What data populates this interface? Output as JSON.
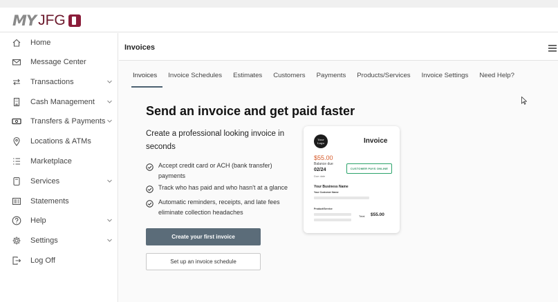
{
  "app": {
    "logo_my": "MY",
    "logo_name": "JFG"
  },
  "sidebar": {
    "items": [
      {
        "label": "Home",
        "icon": "home-icon",
        "expandable": false
      },
      {
        "label": "Message Center",
        "icon": "envelope-icon",
        "expandable": false
      },
      {
        "label": "Transactions",
        "icon": "transfer-arrows-icon",
        "expandable": true
      },
      {
        "label": "Cash Management",
        "icon": "building-icon",
        "expandable": true
      },
      {
        "label": "Transfers & Payments",
        "icon": "cash-icon",
        "expandable": true
      },
      {
        "label": "Locations & ATMs",
        "icon": "location-pin-icon",
        "expandable": false
      },
      {
        "label": "Marketplace",
        "icon": "list-icon",
        "expandable": false
      },
      {
        "label": "Services",
        "icon": "device-icon",
        "expandable": true
      },
      {
        "label": "Statements",
        "icon": "statement-icon",
        "expandable": false
      },
      {
        "label": "Help",
        "icon": "question-icon",
        "expandable": true
      },
      {
        "label": "Settings",
        "icon": "gear-icon",
        "expandable": true
      },
      {
        "label": "Log Off",
        "icon": "logout-icon",
        "expandable": false
      }
    ]
  },
  "main": {
    "page_title": "Invoices",
    "tabs": [
      {
        "label": "Invoices",
        "active": true
      },
      {
        "label": "Invoice Schedules",
        "active": false
      },
      {
        "label": "Estimates",
        "active": false
      },
      {
        "label": "Customers",
        "active": false
      },
      {
        "label": "Payments",
        "active": false
      },
      {
        "label": "Products/Services",
        "active": false
      },
      {
        "label": "Invoice Settings",
        "active": false
      },
      {
        "label": "Need Help?",
        "active": false
      }
    ],
    "hero_title": "Send an invoice and get paid faster",
    "lead": "Create a professional looking invoice in seconds",
    "features": [
      "Accept credit card or ACH (bank transfer) payments",
      "Track who has paid and who hasn't at a glance",
      "Automatic reminders, receipts, and late fees eliminate collection headaches"
    ],
    "primary_button": "Create your first invoice",
    "secondary_button": "Set up an invoice schedule"
  },
  "invoice_card": {
    "logo_text": "Your Logo",
    "title": "Invoice",
    "amount": "$55.00",
    "balance_label": "Balance due",
    "due_date": "02/24",
    "due_label": "Due date",
    "pay_button": "CUSTOMER PAYS ONLINE",
    "business_name": "Your Business Name",
    "customer_name": "Your Customer Name",
    "product_label": "Product/Service",
    "total_label": "Total",
    "total_value": "$55.00"
  },
  "colors": {
    "brand": "#6b1a2c",
    "primary_button": "#5b6c79",
    "amount": "#d65a2a",
    "pay_pill": "#2aa36a"
  }
}
